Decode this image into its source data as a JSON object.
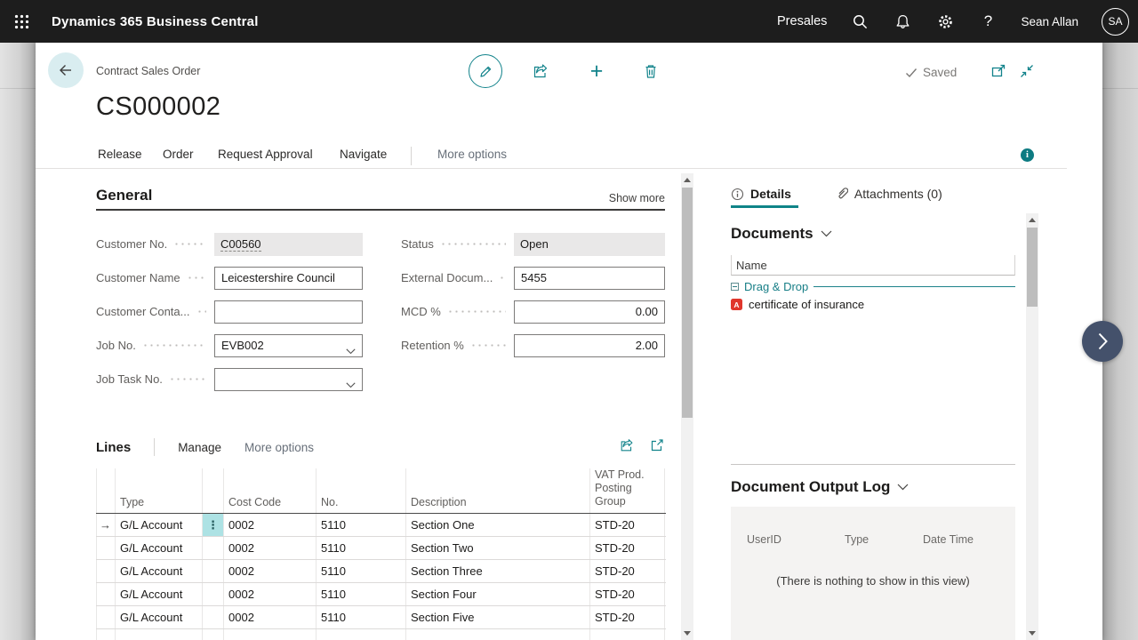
{
  "topbar": {
    "app_title": "Dynamics 365 Business Central",
    "environment": "Presales",
    "user_name": "Sean Allan",
    "user_initials": "SA"
  },
  "page_header": {
    "breadcrumb": "Contract Sales Order",
    "title": "CS000002",
    "saved_label": "Saved"
  },
  "action_bar": {
    "actions": [
      "Release",
      "Order",
      "Request Approval",
      "Navigate"
    ],
    "more_options_label": "More options"
  },
  "general": {
    "heading": "General",
    "show_more_label": "Show more",
    "fields": {
      "customer_no": {
        "label": "Customer No.",
        "value": "C00560"
      },
      "customer_name": {
        "label": "Customer Name",
        "value": "Leicestershire Council"
      },
      "customer_contact": {
        "label": "Customer Conta...",
        "value": ""
      },
      "job_no": {
        "label": "Job No.",
        "value": "EVB002"
      },
      "job_task_no": {
        "label": "Job Task No.",
        "value": ""
      },
      "status": {
        "label": "Status",
        "value": "Open"
      },
      "external_doc": {
        "label": "External Docum...",
        "value": "5455"
      },
      "mcd_pct": {
        "label": "MCD %",
        "value": "0.00"
      },
      "retention_pct": {
        "label": "Retention %",
        "value": "2.00"
      }
    }
  },
  "lines": {
    "heading": "Lines",
    "manage_label": "Manage",
    "more_options_label": "More options",
    "columns": {
      "type": "Type",
      "cost_code": "Cost Code",
      "no": "No.",
      "description": "Description",
      "vat_line1": "VAT Prod.",
      "vat_line2": "Posting Group"
    },
    "rows": [
      {
        "type": "G/L Account",
        "cost_code": "0002",
        "no": "5110",
        "description": "Section One",
        "vat_group": "STD-20"
      },
      {
        "type": "G/L Account",
        "cost_code": "0002",
        "no": "5110",
        "description": "Section Two",
        "vat_group": "STD-20"
      },
      {
        "type": "G/L Account",
        "cost_code": "0002",
        "no": "5110",
        "description": "Section Three",
        "vat_group": "STD-20"
      },
      {
        "type": "G/L Account",
        "cost_code": "0002",
        "no": "5110",
        "description": "Section Four",
        "vat_group": "STD-20"
      },
      {
        "type": "G/L Account",
        "cost_code": "0002",
        "no": "5110",
        "description": "Section Five",
        "vat_group": "STD-20"
      }
    ]
  },
  "factbox": {
    "tabs": {
      "details": "Details",
      "attachments": "Attachments (0)"
    },
    "documents": {
      "heading": "Documents",
      "name_column": "Name",
      "group_label": "Drag & Drop",
      "file_name": "certificate of insurance"
    },
    "output_log": {
      "heading": "Document Output Log",
      "col_userid": "UserID",
      "col_type": "Type",
      "col_datetime": "Date Time",
      "empty_message": "(There is nothing to show in this view)"
    }
  },
  "colors": {
    "accent_teal": "#12838b",
    "topbar_bg": "#1d1d1d",
    "selected_cell": "#ade2e4",
    "info_badge": "#0d7b82",
    "pdf_red": "#e0362c",
    "expand_button": "#44516b"
  }
}
